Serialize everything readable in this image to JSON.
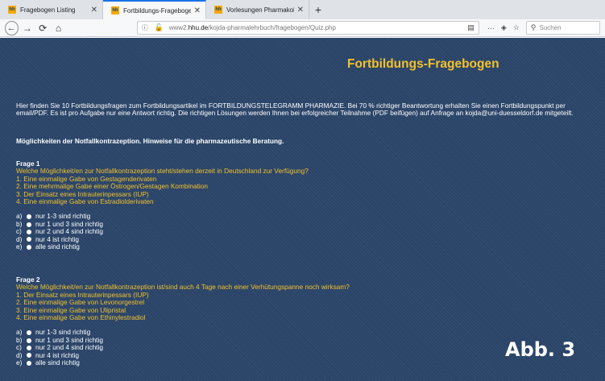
{
  "browser": {
    "tabs": [
      {
        "label": "Fragebogen Listing",
        "favicon": "hhu-favicon"
      },
      {
        "label": "Fortbildungs-Fragebogen",
        "favicon": "hhu-favicon"
      },
      {
        "label": "Vorlesungen Pharmakologie T",
        "favicon": "hhu-favicon"
      }
    ],
    "url_prefix": "www2.",
    "url_domain": "hhu.de",
    "url_path": "/kojda-pharmalehrbuch/fragebogen/Quiz.php",
    "search_placeholder": "Suchen",
    "accent_color": "#1a73e8"
  },
  "page": {
    "title": "Fortbildungs-Fragebogen",
    "intro": "Hier finden Sie 10 Fortbildungsfragen zum Fortbildungsartikel im FORTBILDUNGSTELEGRAMM PHARMAZIE. Bei 70 % richtiger Beantwortung erhalten Sie einen Fortbildungspunkt per email/PDF. Es ist pro Aufgabe nur eine Antwort richtig. Die richtigen Lösungen werden Ihnen bei erfolgreicher Teilnahme (PDF beifügen) auf Anfrage an kojda@uni-duesseldorf.de mitgeteilt.",
    "subtitle": "Möglichkeiten der Notfallkontrazeption. Hinweise für die pharmazeutische Beratung.",
    "background_color": "#2a4468",
    "highlight_color": "#f3c12b",
    "questions": [
      {
        "heading": "Frage 1",
        "text": "Welche Möglichkeit/en zur Notfallkontrazeption steht/stehen derzeit in Deutschland zur Verfügung?",
        "statements": [
          "1. Eine einmalige Gabe von Gestagenderivaten",
          "2. Eine mehrmalige Gabe einer Östrogen/Gestagen Kombination",
          "3. Der Einsatz eines Intrauterinpessars (IUP)",
          "4. Eine einmalige Gabe von Estradiolderivaten"
        ],
        "options": [
          {
            "letter": "a)",
            "text": "nur 1-3 sind richtig"
          },
          {
            "letter": "b)",
            "text": "nur 1 und 3 sind richtig"
          },
          {
            "letter": "c)",
            "text": "nur 2 und 4 sind richtig"
          },
          {
            "letter": "d)",
            "text": "nur 4 ist richtig"
          },
          {
            "letter": "e)",
            "text": "alle sind richtig"
          }
        ]
      },
      {
        "heading": "Frage 2",
        "text": "Welche Möglichkeit/en zur Notfallkontrazeption ist/sind auch 4 Tage nach einer Verhütungspanne noch wirksam?",
        "statements": [
          "1. Der Einsatz eines Intrauterinpessars (IUP)",
          "2. Eine einmalige Gabe von Levonorgestrel",
          "3. Eine einmalige Gabe von Ulipristal",
          "4. Eine einmalige Gabe von Ethinylestradiol"
        ],
        "options": [
          {
            "letter": "a)",
            "text": "nur 1-3 sind richtig"
          },
          {
            "letter": "b)",
            "text": "nur 1 und 3 sind richtig"
          },
          {
            "letter": "c)",
            "text": "nur 2 und 4 sind richtig"
          },
          {
            "letter": "d)",
            "text": "nur 4 ist richtig"
          },
          {
            "letter": "e)",
            "text": "alle sind richtig"
          }
        ]
      }
    ],
    "figure_label": "Abb. 3"
  }
}
